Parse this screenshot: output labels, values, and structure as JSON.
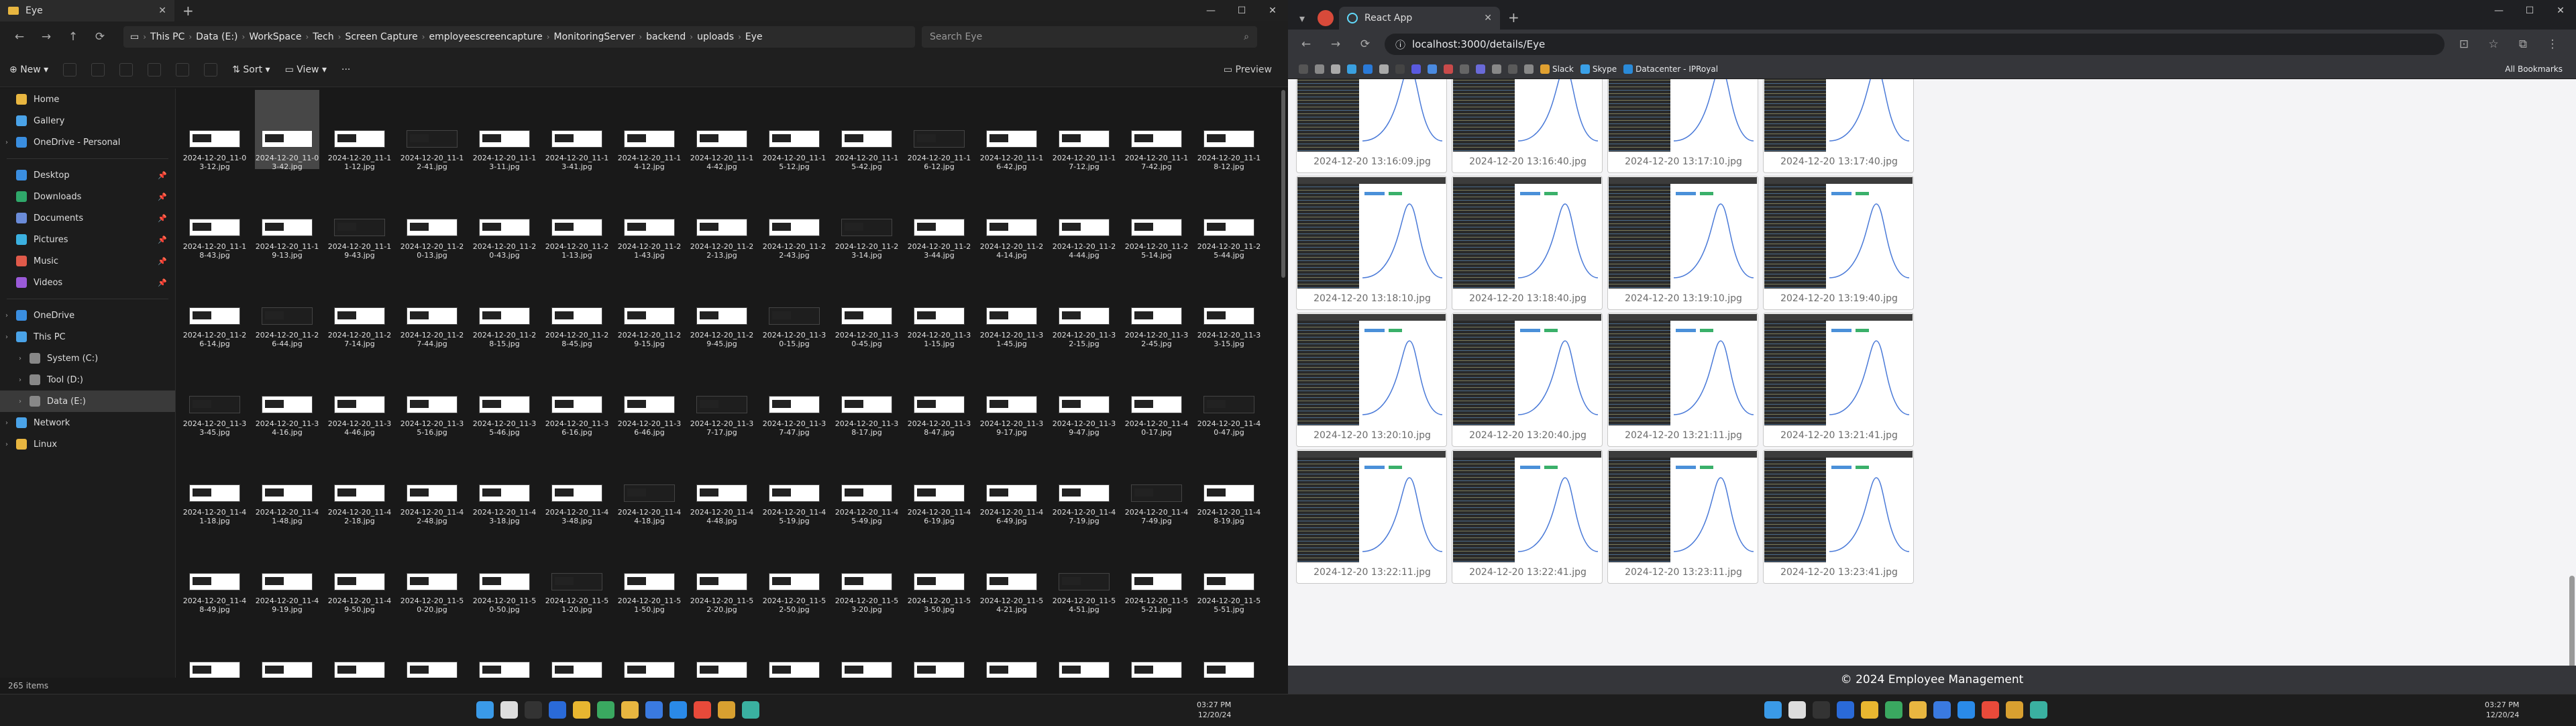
{
  "explorer": {
    "tab_title": "Eye",
    "breadcrumbs": [
      "This PC",
      "Data (E:)",
      "WorkSpace",
      "Tech",
      "Screen Capture",
      "employeescreencapture",
      "MonitoringServer",
      "backend",
      "uploads",
      "Eye"
    ],
    "search_placeholder": "Search Eye",
    "toolbar": {
      "new": "New",
      "sort": "Sort",
      "view": "View",
      "more": "···",
      "preview": "Preview"
    },
    "sidebar": [
      {
        "label": "Home",
        "color": "#e8b640"
      },
      {
        "label": "Gallery",
        "color": "#4aa3e8"
      },
      {
        "label": "OneDrive - Personal",
        "color": "#3a8ee0"
      },
      {
        "label": "Desktop",
        "color": "#3a8ee0",
        "pinned": true
      },
      {
        "label": "Downloads",
        "color": "#2fa86a",
        "pinned": true
      },
      {
        "label": "Documents",
        "color": "#6a8bd8",
        "pinned": true
      },
      {
        "label": "Pictures",
        "color": "#3bb0e0",
        "pinned": true
      },
      {
        "label": "Music",
        "color": "#e05a4a",
        "pinned": true
      },
      {
        "label": "Videos",
        "color": "#9a5ad8",
        "pinned": true
      },
      {
        "label": "OneDrive",
        "color": "#3a8ee0"
      },
      {
        "label": "This PC",
        "color": "#4aa3e8"
      },
      {
        "label": "System (C:)",
        "color": "#888"
      },
      {
        "label": "Tool (D:)",
        "color": "#888"
      },
      {
        "label": "Data (E:)",
        "color": "#888",
        "selected": true
      },
      {
        "label": "Network",
        "color": "#4aa3e8"
      },
      {
        "label": "Linux",
        "color": "#e8b640"
      }
    ],
    "files": [
      "2024-12-20_11-03-12.jpg",
      "2024-12-20_11-03-42.jpg",
      "2024-12-20_11-11-12.jpg",
      "2024-12-20_11-12-41.jpg",
      "2024-12-20_11-13-11.jpg",
      "2024-12-20_11-13-41.jpg",
      "2024-12-20_11-14-12.jpg",
      "2024-12-20_11-14-42.jpg",
      "2024-12-20_11-15-12.jpg",
      "2024-12-20_11-15-42.jpg",
      "2024-12-20_11-16-12.jpg",
      "2024-12-20_11-16-42.jpg",
      "2024-12-20_11-17-12.jpg",
      "2024-12-20_11-17-42.jpg",
      "2024-12-20_11-18-12.jpg",
      "2024-12-20_11-18-43.jpg",
      "2024-12-20_11-19-13.jpg",
      "2024-12-20_11-19-43.jpg",
      "2024-12-20_11-20-13.jpg",
      "2024-12-20_11-20-43.jpg",
      "2024-12-20_11-21-13.jpg",
      "2024-12-20_11-21-43.jpg",
      "2024-12-20_11-22-13.jpg",
      "2024-12-20_11-22-43.jpg",
      "2024-12-20_11-23-14.jpg",
      "2024-12-20_11-23-44.jpg",
      "2024-12-20_11-24-14.jpg",
      "2024-12-20_11-24-44.jpg",
      "2024-12-20_11-25-14.jpg",
      "2024-12-20_11-25-44.jpg",
      "2024-12-20_11-26-14.jpg",
      "2024-12-20_11-26-44.jpg",
      "2024-12-20_11-27-14.jpg",
      "2024-12-20_11-27-44.jpg",
      "2024-12-20_11-28-15.jpg",
      "2024-12-20_11-28-45.jpg",
      "2024-12-20_11-29-15.jpg",
      "2024-12-20_11-29-45.jpg",
      "2024-12-20_11-30-15.jpg",
      "2024-12-20_11-30-45.jpg",
      "2024-12-20_11-31-15.jpg",
      "2024-12-20_11-31-45.jpg",
      "2024-12-20_11-32-15.jpg",
      "2024-12-20_11-32-45.jpg",
      "2024-12-20_11-33-15.jpg",
      "2024-12-20_11-33-45.jpg",
      "2024-12-20_11-34-16.jpg",
      "2024-12-20_11-34-46.jpg",
      "2024-12-20_11-35-16.jpg",
      "2024-12-20_11-35-46.jpg",
      "2024-12-20_11-36-16.jpg",
      "2024-12-20_11-36-46.jpg",
      "2024-12-20_11-37-17.jpg",
      "2024-12-20_11-37-47.jpg",
      "2024-12-20_11-38-17.jpg",
      "2024-12-20_11-38-47.jpg",
      "2024-12-20_11-39-17.jpg",
      "2024-12-20_11-39-47.jpg",
      "2024-12-20_11-40-17.jpg",
      "2024-12-20_11-40-47.jpg",
      "2024-12-20_11-41-18.jpg",
      "2024-12-20_11-41-48.jpg",
      "2024-12-20_11-42-18.jpg",
      "2024-12-20_11-42-48.jpg",
      "2024-12-20_11-43-18.jpg",
      "2024-12-20_11-43-48.jpg",
      "2024-12-20_11-44-18.jpg",
      "2024-12-20_11-44-48.jpg",
      "2024-12-20_11-45-19.jpg",
      "2024-12-20_11-45-49.jpg",
      "2024-12-20_11-46-19.jpg",
      "2024-12-20_11-46-49.jpg",
      "2024-12-20_11-47-19.jpg",
      "2024-12-20_11-47-49.jpg",
      "2024-12-20_11-48-19.jpg",
      "2024-12-20_11-48-49.jpg",
      "2024-12-20_11-49-19.jpg",
      "2024-12-20_11-49-50.jpg",
      "2024-12-20_11-50-20.jpg",
      "2024-12-20_11-50-50.jpg",
      "2024-12-20_11-51-20.jpg",
      "2024-12-20_11-51-50.jpg",
      "2024-12-20_11-52-20.jpg",
      "2024-12-20_11-52-50.jpg",
      "2024-12-20_11-53-20.jpg",
      "2024-12-20_11-53-50.jpg",
      "2024-12-20_11-54-21.jpg",
      "2024-12-20_11-54-51.jpg",
      "2024-12-20_11-55-21.jpg",
      "2024-12-20_11-55-51.jpg"
    ],
    "status": "265 items"
  },
  "browser": {
    "tab_title": "React App",
    "url": "localhost:3000/details/Eye",
    "bookmarks": [
      "Slack",
      "Skype",
      "Datacenter - IPRoyal"
    ],
    "all_bookmarks": "All Bookmarks",
    "captures": [
      "2024-12-20 13:16:09.jpg",
      "2024-12-20 13:16:40.jpg",
      "2024-12-20 13:17:10.jpg",
      "2024-12-20 13:17:40.jpg",
      "2024-12-20 13:18:10.jpg",
      "2024-12-20 13:18:40.jpg",
      "2024-12-20 13:19:10.jpg",
      "2024-12-20 13:19:40.jpg",
      "2024-12-20 13:20:10.jpg",
      "2024-12-20 13:20:40.jpg",
      "2024-12-20 13:21:11.jpg",
      "2024-12-20 13:21:41.jpg",
      "2024-12-20 13:22:11.jpg",
      "2024-12-20 13:22:41.jpg",
      "2024-12-20 13:23:11.jpg",
      "2024-12-20 13:23:41.jpg"
    ],
    "footer": "© 2024 Employee Management"
  },
  "taskbar": {
    "time": "03:27 PM",
    "date": "12/20/24"
  }
}
